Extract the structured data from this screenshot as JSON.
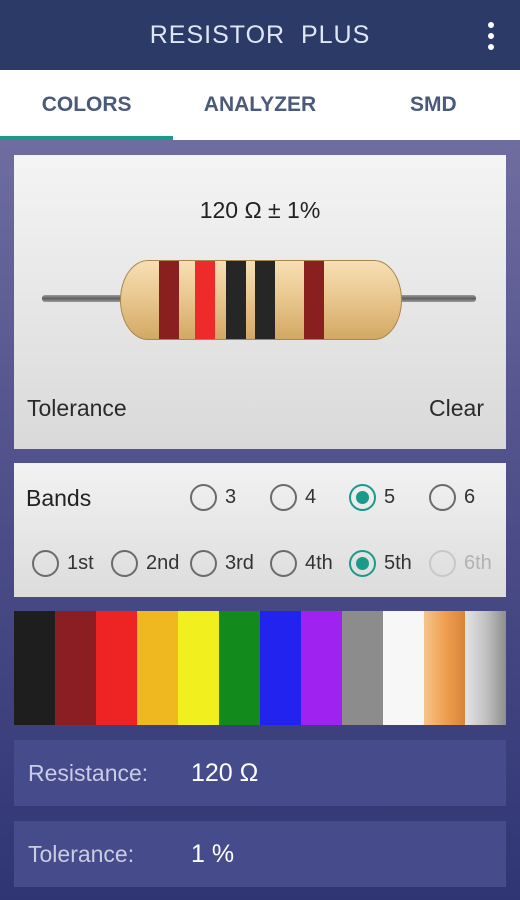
{
  "app": {
    "title": "RESISTOR  PLUS",
    "menu_icon": "more-vert-icon"
  },
  "tabs": [
    {
      "label": "COLORS",
      "active": true
    },
    {
      "label": "ANALYZER",
      "active": false
    },
    {
      "label": "SMD",
      "active": false
    }
  ],
  "resistor": {
    "value_text": "120 Ω ± 1%",
    "bands": [
      {
        "color": "#8a1f1f"
      },
      {
        "color": "#ee2a2a"
      },
      {
        "color": "#262626"
      },
      {
        "color": "#262626"
      },
      {
        "color": "#8a1f1f"
      }
    ],
    "tolerance_label": "Tolerance",
    "clear_label": "Clear"
  },
  "band_count": {
    "label": "Bands",
    "options": [
      {
        "label": "3",
        "checked": false
      },
      {
        "label": "4",
        "checked": false
      },
      {
        "label": "5",
        "checked": true
      },
      {
        "label": "6",
        "checked": false
      }
    ]
  },
  "band_select": {
    "options": [
      {
        "label": "1st",
        "checked": false,
        "enabled": true
      },
      {
        "label": "2nd",
        "checked": false,
        "enabled": true
      },
      {
        "label": "3rd",
        "checked": false,
        "enabled": true
      },
      {
        "label": "4th",
        "checked": false,
        "enabled": true
      },
      {
        "label": "5th",
        "checked": true,
        "enabled": true
      },
      {
        "label": "6th",
        "checked": false,
        "enabled": false
      }
    ]
  },
  "palette": [
    {
      "name": "black",
      "color": "#1e1e1e"
    },
    {
      "name": "brown",
      "color": "#8b1e22"
    },
    {
      "name": "red",
      "color": "#ee2424"
    },
    {
      "name": "orange",
      "color": "#f0b820"
    },
    {
      "name": "yellow",
      "color": "#f2ef1e"
    },
    {
      "name": "green",
      "color": "#138a1c"
    },
    {
      "name": "blue",
      "color": "#2323f0"
    },
    {
      "name": "violet",
      "color": "#a022f0"
    },
    {
      "name": "gray",
      "color": "#8c8c8c"
    },
    {
      "name": "white",
      "color": "#f7f7f7"
    },
    {
      "name": "gold",
      "color": "#f0a050"
    },
    {
      "name": "silver",
      "color": "#c2c2c2"
    }
  ],
  "results": {
    "resistance_label": "Resistance:",
    "resistance_value": "120 Ω",
    "tolerance_label": "Tolerance:",
    "tolerance_value": "1 %"
  }
}
